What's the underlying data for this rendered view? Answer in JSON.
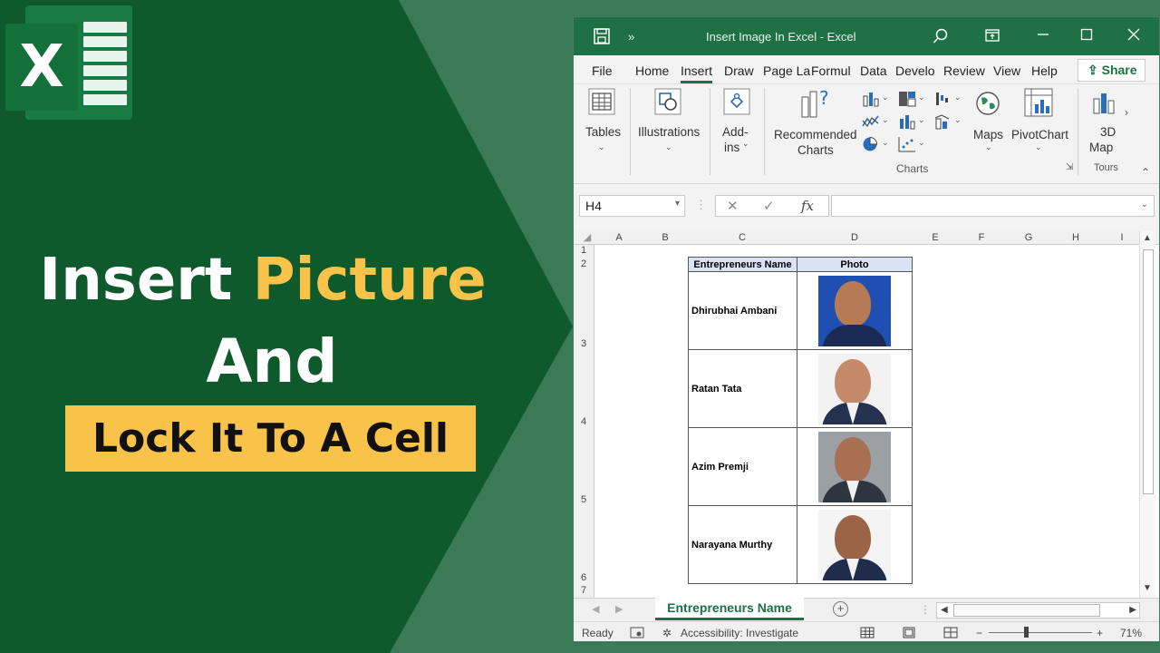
{
  "promo": {
    "logo_letter": "X",
    "headline_word1": "Insert",
    "headline_word2": "Picture",
    "headline_line2": "And",
    "headline_line3": "Lock It To A Cell",
    "accent_color": "#f9c248",
    "bg_dark": "#0e5a2c",
    "bg_light": "#3a7a55"
  },
  "window": {
    "title": "Insert Image In Excel  -  Excel",
    "more_glyph": "»"
  },
  "menu": {
    "items": [
      "File",
      "Home",
      "Insert",
      "Draw",
      "Page La",
      "Formul",
      "Data",
      "Develo",
      "Review",
      "View",
      "Help"
    ],
    "active": "Insert",
    "share_label": "Share"
  },
  "ribbon": {
    "tables": "Tables",
    "illustrations": "Illustrations",
    "addins_line1": "Add-",
    "addins_line2": "ins",
    "recommended_line1": "Recommended",
    "recommended_line2": "Charts",
    "maps": "Maps",
    "pivotchart": "PivotChart",
    "map3d_line1": "3D",
    "map3d_line2": "Map",
    "group_charts": "Charts",
    "group_tours": "Tours"
  },
  "formula_bar": {
    "name_box": "H4",
    "fx": "fx",
    "cancel": "✕",
    "enter": "✓",
    "value": ""
  },
  "sheet": {
    "columns": [
      "A",
      "B",
      "C",
      "D",
      "E",
      "F",
      "G",
      "H",
      "I"
    ],
    "rows": [
      "1",
      "2",
      "3",
      "4",
      "5",
      "6",
      "7"
    ],
    "table_headers": [
      "Entrepreneurs Name",
      "Photo"
    ],
    "entries": [
      {
        "name": "Dhirubhai Ambani"
      },
      {
        "name": "Ratan Tata"
      },
      {
        "name": "Azim Premji"
      },
      {
        "name": "Narayana Murthy"
      }
    ],
    "tab_name": "Entrepreneurs Name",
    "add_sheet": "+"
  },
  "status": {
    "ready": "Ready",
    "accessibility": "Accessibility: Investigate",
    "zoom": "71%",
    "zoom_minus": "−",
    "zoom_plus": "+"
  }
}
